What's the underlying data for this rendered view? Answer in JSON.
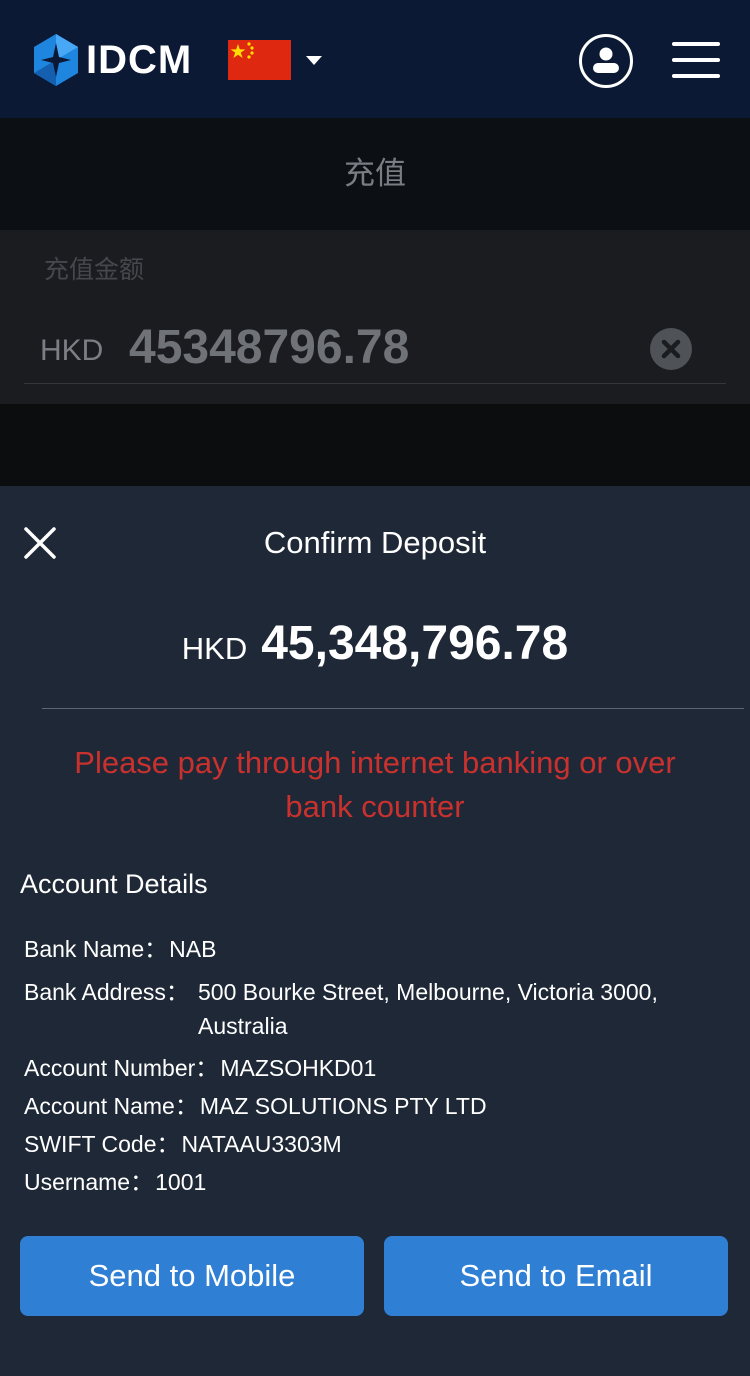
{
  "header": {
    "brand": "IDCM",
    "flag_icon": "china-flag-icon",
    "colors": {
      "background": "#0b1934"
    }
  },
  "background_page": {
    "title": "充值",
    "amount_label": "充值金额",
    "currency": "HKD",
    "amount_value": "45348796.78"
  },
  "modal": {
    "title": "Confirm Deposit",
    "currency": "HKD",
    "amount": "45,348,796.78",
    "notice": "Please pay through internet banking or over bank counter",
    "section_title": "Account Details",
    "details": {
      "bank_name_label": "Bank Name：",
      "bank_name": "NAB",
      "bank_address_label": "Bank Address：",
      "bank_address": "500 Bourke Street, Melbourne, Victoria 3000, Australia",
      "account_number_label": "Account Number：",
      "account_number": "MAZSOHKD01",
      "account_name_label": "Account Name：",
      "account_name": "MAZ SOLUTIONS PTY LTD",
      "swift_code_label": "SWIFT Code：",
      "swift_code": "NATAAU3303M",
      "username_label": "Username：",
      "username": "1001"
    },
    "buttons": {
      "send_to_mobile": "Send to Mobile",
      "send_to_email": "Send to Email"
    },
    "colors": {
      "background": "#1f2836",
      "notice": "#c9312e",
      "button": "#2f7fd4"
    }
  }
}
